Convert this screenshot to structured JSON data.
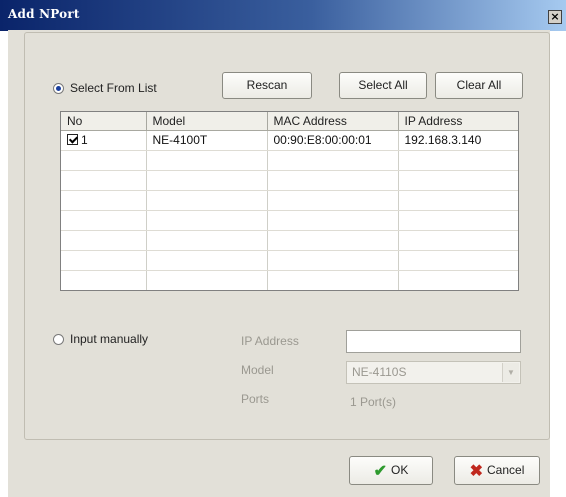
{
  "window": {
    "title": "Add NPort",
    "close_glyph": "×"
  },
  "select_from_list": {
    "label": "Select From List",
    "selected": true,
    "buttons": {
      "rescan": "Rescan",
      "select_all": "Select All",
      "clear_all": "Clear All"
    }
  },
  "device_table": {
    "columns": [
      "No",
      "Model",
      "MAC Address",
      "IP Address"
    ],
    "rows": [
      {
        "checked": true,
        "no": "1",
        "model": "NE-4100T",
        "mac": "00:90:E8:00:00:01",
        "ip": "192.168.3.140"
      }
    ],
    "empty_row_count": 7
  },
  "input_manually": {
    "label": "Input manually",
    "selected": false,
    "ip_address_label": "IP Address",
    "ip_address_value": "",
    "model_label": "Model",
    "model_value": "NE-4110S",
    "ports_label": "Ports",
    "ports_value": "1 Port(s)"
  },
  "footer": {
    "ok": "OK",
    "cancel": "Cancel"
  },
  "icons": {
    "ok": "check-icon",
    "cancel": "x-icon",
    "close": "close-icon"
  }
}
